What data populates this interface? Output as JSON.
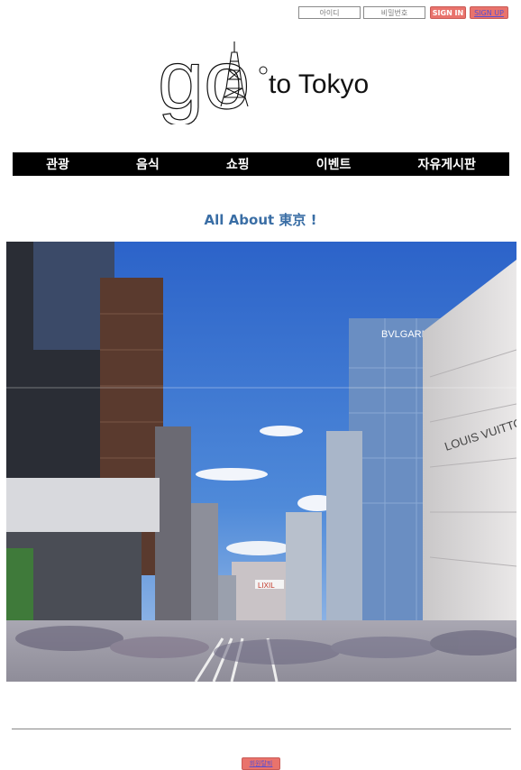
{
  "login": {
    "id_placeholder": "아이디",
    "password_placeholder": "비밀번호",
    "signin_label": "SIGN IN",
    "signup_label": "SIGN UP"
  },
  "logo": {
    "big_text": "go",
    "small_text": "to Tokyo"
  },
  "nav": {
    "items": [
      {
        "label": "관광"
      },
      {
        "label": "음식"
      },
      {
        "label": "쇼핑"
      },
      {
        "label": "이벤트"
      },
      {
        "label": "자유게시판"
      }
    ]
  },
  "main": {
    "title": "All About 東京 !",
    "hero_signs": {
      "lv": "LOUIS VUITTON",
      "bvlgari": "BVLGARI",
      "lixil": "LIXIL"
    }
  },
  "footer": {
    "withdraw_label": "회원탈퇴"
  },
  "colors": {
    "accent_button": "#e9736c",
    "nav_bg": "#000000",
    "title": "#3a6ea5",
    "link_text": "#5a4fd0"
  }
}
